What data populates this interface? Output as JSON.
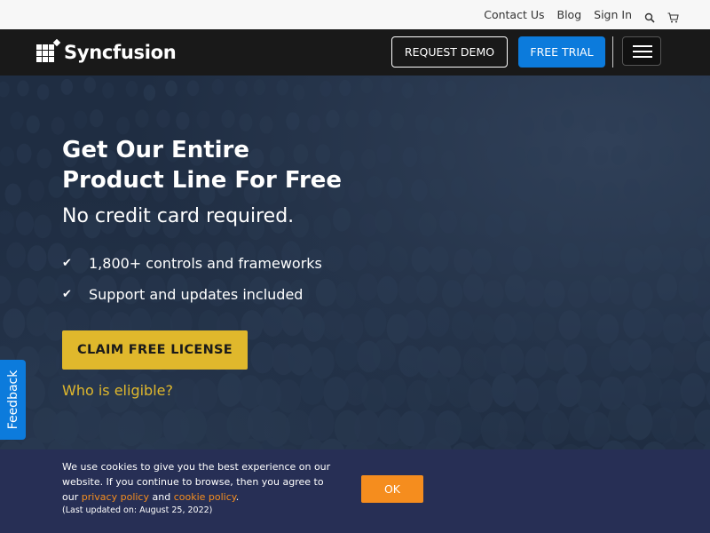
{
  "topbar": {
    "contact_label": "Contact Us",
    "blog_label": "Blog",
    "signin_label": "Sign In",
    "search_icon": "search-icon",
    "cart_icon": "cart-icon"
  },
  "header": {
    "logo_text": "Syncfusion",
    "request_demo_label": "REQUEST DEMO",
    "free_trial_label": "FREE TRIAL",
    "menu_icon": "hamburger-menu-icon"
  },
  "hero": {
    "title_line1": "Get Our Entire",
    "title_line2": "Product Line For Free",
    "subtitle": "No credit card required.",
    "features": [
      {
        "check": "✔",
        "text": "1,800+ controls and frameworks"
      },
      {
        "check": "✔",
        "text": "Support and updates included"
      }
    ],
    "cta_label": "CLAIM FREE LICENSE",
    "eligible_link": "Who is eligible?"
  },
  "feedback": {
    "label": "Feedback"
  },
  "cookie": {
    "text_part1": "We use cookies to give you the best experience on our website. If you continue to browse, then you agree to our",
    "privacy_link": "privacy policy",
    "and_text": "and",
    "cookie_link": "cookie policy",
    "period": ".",
    "updated": "(Last updated on: August 25, 2022)",
    "ok_label": "OK"
  },
  "colors": {
    "topbar_bg": "#f7f7f7",
    "header_bg": "#191919",
    "trial_blue": "#0c7bdc",
    "hero_bg": "#1f2d42",
    "claim_yellow": "#e0b82c",
    "cookie_bg": "#272f55",
    "ok_orange": "#f58d1e"
  }
}
